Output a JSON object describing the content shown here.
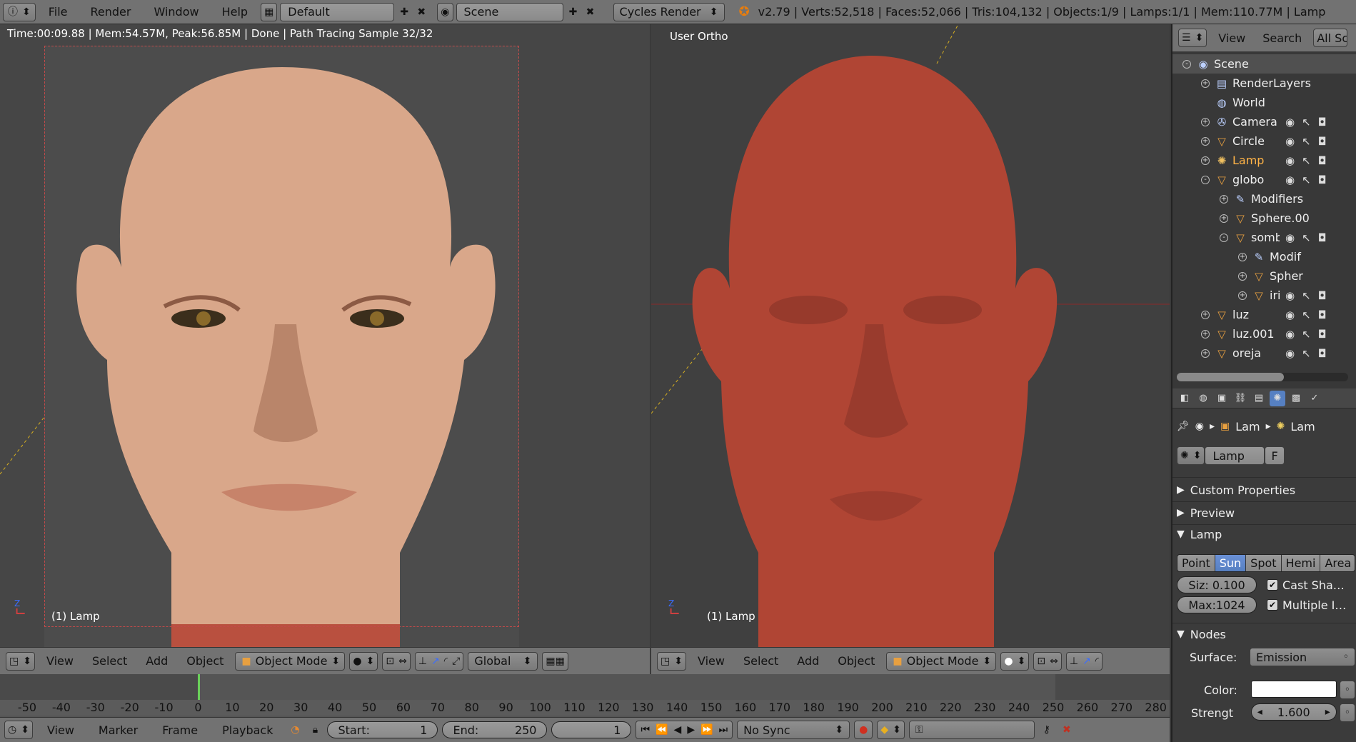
{
  "topbar": {
    "menu": [
      "File",
      "Render",
      "Window",
      "Help"
    ],
    "screen_layout": "Default",
    "scene": "Scene",
    "engine": "Cycles Render",
    "stats": "v2.79 | Verts:52,518 | Faces:52,066 | Tris:104,132 | Objects:1/9 | Lamps:1/1 | Mem:110.77M | Lamp"
  },
  "left_viewport": {
    "render_status": "Time:00:09.88 | Mem:54.57M, Peak:56.85M | Done | Path Tracing Sample 32/32",
    "object_label": "(1) Lamp",
    "skin_color": "#d9a78a"
  },
  "right_viewport": {
    "view_name": "User Ortho",
    "object_label": "(1) Lamp",
    "skin_color": "#b04534"
  },
  "viewport_header": {
    "menu": [
      "View",
      "Select",
      "Add",
      "Object"
    ],
    "mode": "Object Mode",
    "orientation": "Global"
  },
  "timeline": {
    "ticks": [
      "-50",
      "-40",
      "-30",
      "-20",
      "-10",
      "0",
      "10",
      "20",
      "30",
      "40",
      "50",
      "60",
      "70",
      "80",
      "90",
      "100",
      "110",
      "120",
      "130",
      "140",
      "150",
      "160",
      "170",
      "180",
      "190",
      "200",
      "210",
      "220",
      "230",
      "240",
      "250",
      "260",
      "270",
      "280"
    ],
    "current_frame": 1
  },
  "bottombar": {
    "menu": [
      "View",
      "Marker",
      "Frame",
      "Playback"
    ],
    "start_label": "Start:",
    "start_value": "1",
    "end_label": "End:",
    "end_value": "250",
    "frame_value": "1",
    "sync": "No Sync"
  },
  "outliner": {
    "header": [
      "View",
      "Search",
      "All Scen"
    ],
    "items": [
      {
        "label": "Scene",
        "icon": "scene-icon",
        "glyph": "◉",
        "indent": 0,
        "expander": "-"
      },
      {
        "label": "RenderLayers",
        "icon": "render-layers-icon",
        "glyph": "▤",
        "indent": 1,
        "expander": "+"
      },
      {
        "label": "World",
        "icon": "world-icon",
        "glyph": "◍",
        "indent": 1,
        "expander": ""
      },
      {
        "label": "Camera",
        "icon": "camera-icon",
        "glyph": "✇",
        "indent": 1,
        "expander": "+"
      },
      {
        "label": "Circle",
        "icon": "mesh-icon",
        "glyph": "▽",
        "indent": 1,
        "expander": "+"
      },
      {
        "label": "Lamp",
        "icon": "lamp-icon",
        "glyph": "✺",
        "indent": 1,
        "expander": "+"
      },
      {
        "label": "globo",
        "icon": "mesh-icon",
        "glyph": "▽",
        "indent": 1,
        "expander": "-"
      },
      {
        "label": "Modifiers",
        "icon": "wrench-icon",
        "glyph": "✎",
        "indent": 2,
        "expander": "+"
      },
      {
        "label": "Sphere.00",
        "icon": "mesh-data-icon",
        "glyph": "▽",
        "indent": 2,
        "expander": "+"
      },
      {
        "label": "sombra",
        "icon": "mesh-icon",
        "glyph": "▽",
        "indent": 2,
        "expander": "-"
      },
      {
        "label": "Modif",
        "icon": "wrench-icon",
        "glyph": "✎",
        "indent": 3,
        "expander": "+"
      },
      {
        "label": "Spher",
        "icon": "mesh-data-icon",
        "glyph": "▽",
        "indent": 3,
        "expander": "+"
      },
      {
        "label": "irirs",
        "icon": "mesh-icon",
        "glyph": "▽",
        "indent": 3,
        "expander": "+"
      },
      {
        "label": "luz",
        "icon": "mesh-icon",
        "glyph": "▽",
        "indent": 1,
        "expander": "+"
      },
      {
        "label": "luz.001",
        "icon": "mesh-icon",
        "glyph": "▽",
        "indent": 1,
        "expander": "+"
      },
      {
        "label": "oreja",
        "icon": "mesh-icon",
        "glyph": "▽",
        "indent": 1,
        "expander": "+"
      }
    ]
  },
  "properties": {
    "breadcrumb": [
      "Lam",
      "Lam"
    ],
    "datablock": "Lamp",
    "fake_user": "F",
    "sections": [
      "Custom Properties",
      "Preview",
      "Lamp"
    ],
    "lamp_types": [
      "Point",
      "Sun",
      "Spot",
      "Hemi",
      "Area"
    ],
    "active_type": "Sun",
    "size": "Siz: 0.100",
    "max": "Max:1024",
    "cast_shadow": "Cast Sha…",
    "multiple": "Multiple I…",
    "nodes_section": "Nodes",
    "surface_label": "Surface:",
    "surface_value": "Emission",
    "color_label": "Color:",
    "strength_label": "Strengt",
    "strength_value": "1.600"
  }
}
